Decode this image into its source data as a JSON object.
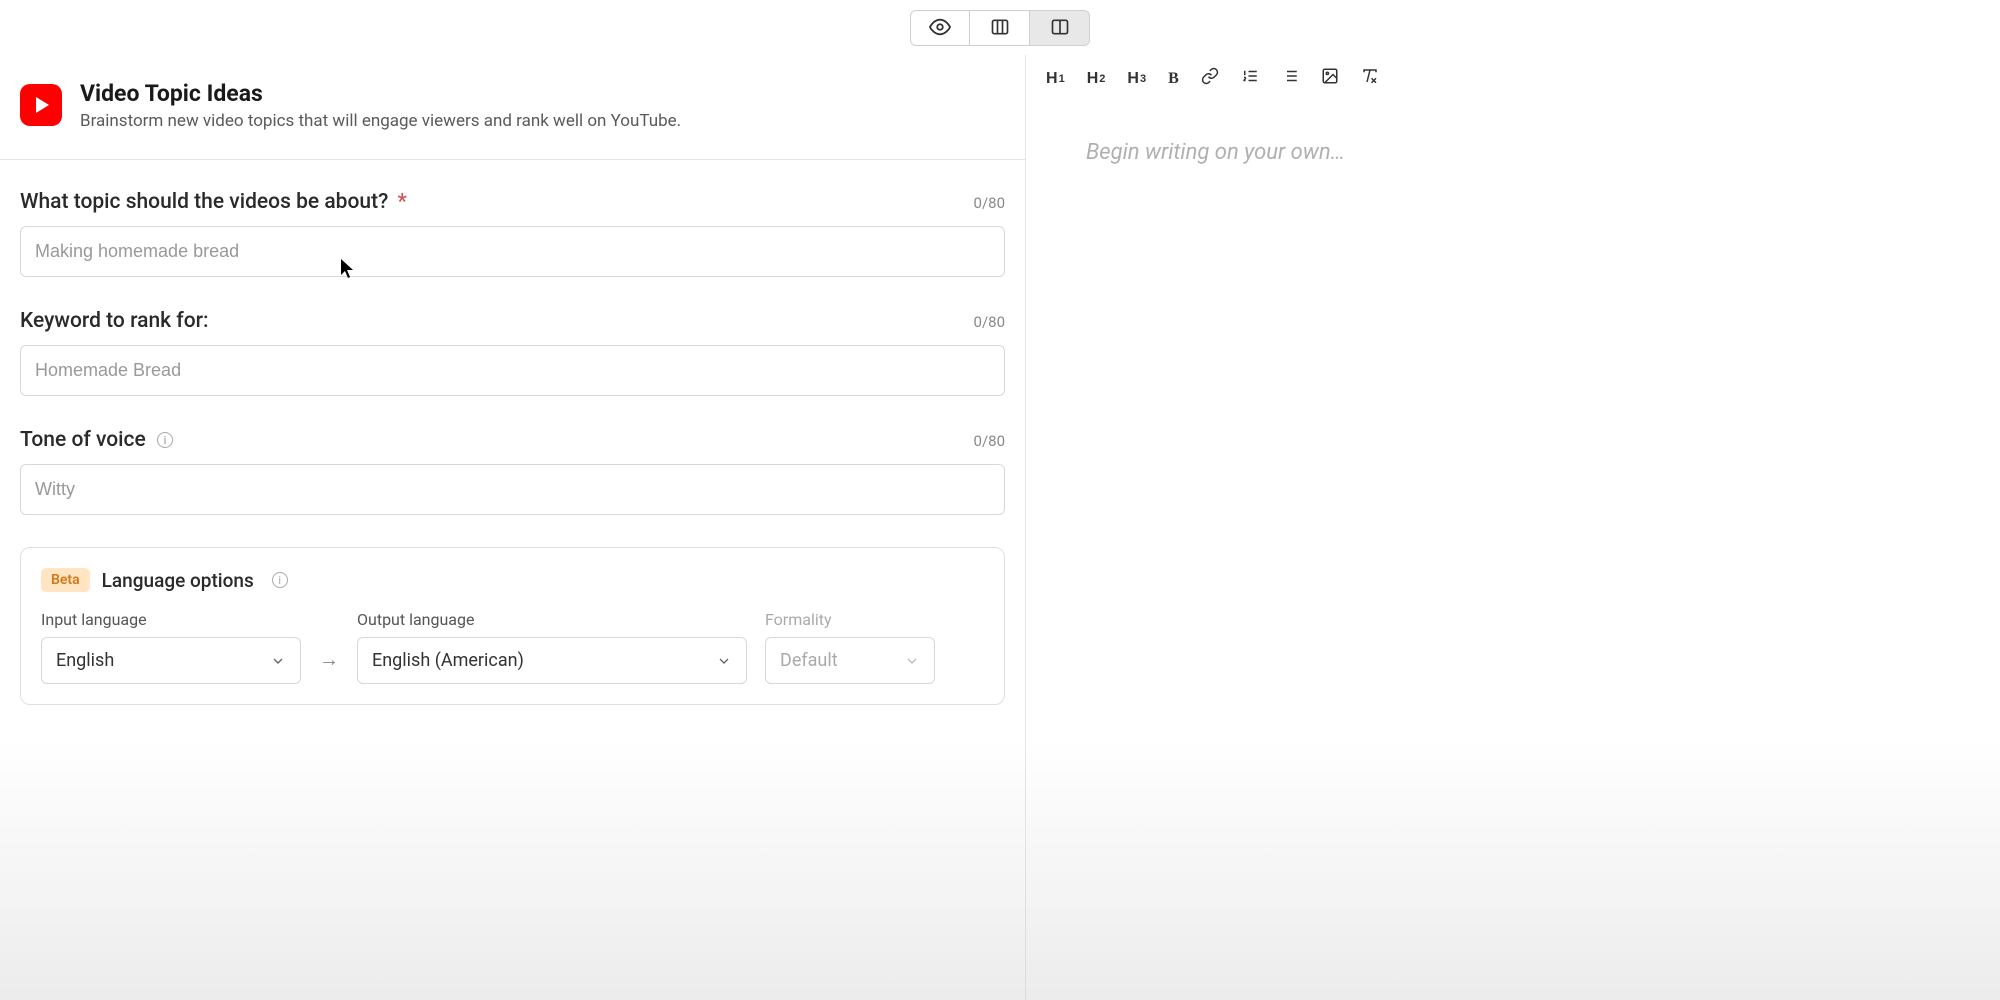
{
  "header": {
    "title": "Video Topic Ideas",
    "subtitle": "Brainstorm new video topics that will engage viewers and rank well on YouTube."
  },
  "topToolbar": {
    "view_icon": "eye-icon",
    "columns_icon": "columns-icon",
    "split_icon": "split-icon"
  },
  "fields": {
    "topic": {
      "label": "What topic should the videos be about?",
      "required": "*",
      "counter": "0/80",
      "placeholder": "Making homemade bread",
      "value": ""
    },
    "keyword": {
      "label": "Keyword to rank for:",
      "counter": "0/80",
      "placeholder": "Homemade Bread",
      "value": ""
    },
    "tone": {
      "label": "Tone of voice",
      "counter": "0/80",
      "placeholder": "Witty",
      "value": ""
    }
  },
  "language": {
    "beta": "Beta",
    "title": "Language options",
    "input": {
      "label": "Input language",
      "value": "English"
    },
    "output": {
      "label": "Output language",
      "value": "English (American)"
    },
    "formality": {
      "label": "Formality",
      "value": "Default"
    }
  },
  "editor": {
    "placeholder": "Begin writing on your own…",
    "toolbar": {
      "h1": "H",
      "h1sub": "1",
      "h2": "H",
      "h2sub": "2",
      "h3": "H",
      "h3sub": "3",
      "bold": "B"
    }
  }
}
